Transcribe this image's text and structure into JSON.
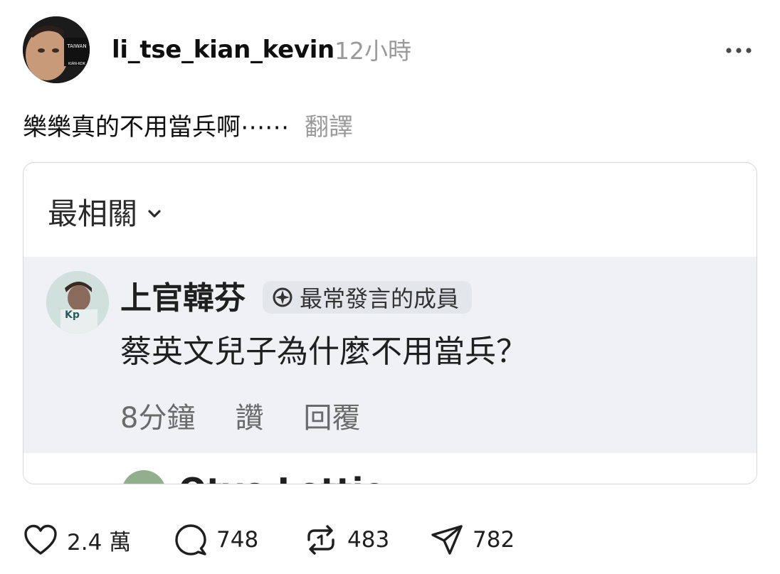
{
  "post": {
    "username": "li_tse_kian_kevin",
    "time": "12小時",
    "text": "樂樂真的不用當兵啊⋯⋯",
    "translate_label": "翻譯",
    "avatar_caption_top": "TAIWAN",
    "avatar_caption_bottom": "KIÁN-KOK"
  },
  "screenshot": {
    "sort_label": "最相關",
    "comment": {
      "author": "上官韓芬",
      "badge_label": "最常發言的成員",
      "text": "蔡英文兒子為什麼不用當兵？",
      "time": "8分鐘",
      "like_label": "讚",
      "reply_label": "回覆"
    },
    "next_comment_author": "Otyo Lottie"
  },
  "actions": {
    "likes": "2.4 萬",
    "comments": "748",
    "reposts": "483",
    "shares": "782"
  },
  "colors": {
    "primary_text": "#0f0f0f",
    "secondary_text": "#9a9a9a",
    "card_border": "#d6d6d6",
    "comment_background": "#eff1f5"
  },
  "icons": {
    "more": "more-icon",
    "like": "heart-icon",
    "comment": "comment-bubble-icon",
    "repost": "repost-icon",
    "share": "send-icon",
    "sort": "chevron-down-icon",
    "badge": "top-contributor-icon"
  }
}
